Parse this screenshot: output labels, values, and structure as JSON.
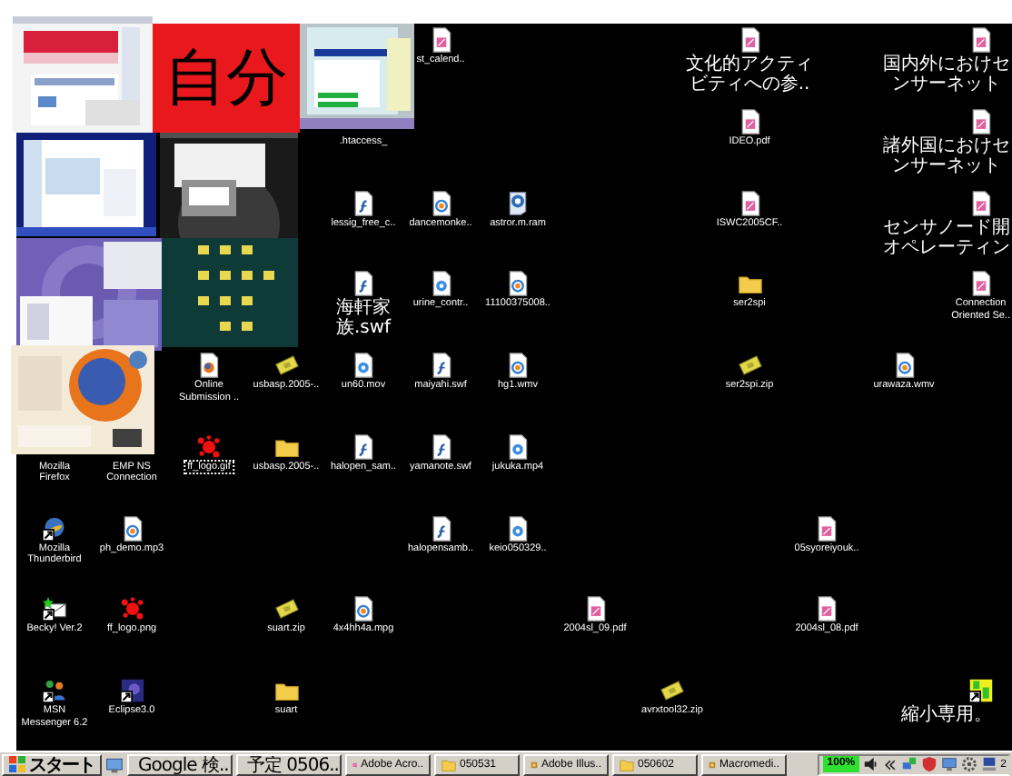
{
  "collage": {
    "badge": "自分"
  },
  "desktop": {
    "icons": [
      {
        "label": "st_calend..",
        "kind": "pdf",
        "shortcut": false,
        "selected": false
      },
      {
        "label": "文化的アクティビティへの参..",
        "kind": "pdf",
        "shortcut": false,
        "selected": false
      },
      {
        "label": "国内外におけセンサーネット",
        "kind": "pdf",
        "shortcut": false,
        "selected": false
      },
      {
        "label": ".htaccess_",
        "kind": "hidden",
        "selected": false
      },
      {
        "label": "IDEO.pdf",
        "kind": "pdf",
        "shortcut": false,
        "selected": false
      },
      {
        "label": "諸外国におけセンサーネット",
        "kind": "pdf",
        "shortcut": false,
        "selected": false
      },
      {
        "label": "lessig_free_c..",
        "kind": "swf",
        "shortcut": false,
        "selected": false
      },
      {
        "label": "dancemonke..",
        "kind": "wmv",
        "shortcut": false,
        "selected": false
      },
      {
        "label": "astror.m.ram",
        "kind": "ram",
        "shortcut": false,
        "selected": false
      },
      {
        "label": "ISWC2005CF..",
        "kind": "pdf",
        "shortcut": false,
        "selected": false
      },
      {
        "label": "センサノード開オペレーティン",
        "kind": "pdf",
        "shortcut": false,
        "selected": false
      },
      {
        "label": "海軒家族.swf",
        "kind": "swf",
        "shortcut": false,
        "selected": false
      },
      {
        "label": "urine_contr..",
        "kind": "qt",
        "shortcut": false,
        "selected": false
      },
      {
        "label": "11100375008..",
        "kind": "wmv",
        "shortcut": false,
        "selected": false
      },
      {
        "label": "ser2spi",
        "kind": "folder",
        "shortcut": false,
        "selected": false
      },
      {
        "label": "Connection\nOriented Se..",
        "kind": "pdf",
        "shortcut": false,
        "selected": false
      },
      {
        "label": "Online\nSubmission ..",
        "kind": "webdoc",
        "shortcut": false,
        "selected": false
      },
      {
        "label": "usbasp.2005-..",
        "kind": "zip",
        "shortcut": false,
        "selected": false
      },
      {
        "label": "un60.mov",
        "kind": "qt",
        "shortcut": false,
        "selected": false
      },
      {
        "label": "maiyahi.swf",
        "kind": "swf",
        "shortcut": false,
        "selected": false
      },
      {
        "label": "hg1.wmv",
        "kind": "wmv",
        "shortcut": false,
        "selected": false
      },
      {
        "label": "ser2spi.zip",
        "kind": "zip",
        "shortcut": false,
        "selected": false
      },
      {
        "label": "urawaza.wmv",
        "kind": "wmv",
        "shortcut": false,
        "selected": false
      },
      {
        "label": "Mozilla\nFirefox",
        "kind": "hidden",
        "selected": false
      },
      {
        "label": "EMP NS\nConnection",
        "kind": "hidden",
        "selected": false
      },
      {
        "label": "ff_logo.gif",
        "kind": "splat",
        "shortcut": false,
        "selected": true
      },
      {
        "label": "usbasp.2005-..",
        "kind": "folder",
        "shortcut": false,
        "selected": false
      },
      {
        "label": "halopen_sam..",
        "kind": "swf",
        "shortcut": false,
        "selected": false
      },
      {
        "label": "yamanote.swf",
        "kind": "swf",
        "shortcut": false,
        "selected": false
      },
      {
        "label": "jukuka.mp4",
        "kind": "qt",
        "shortcut": false,
        "selected": false
      },
      {
        "label": "Mozilla\nThunderbird",
        "kind": "thunderbird",
        "shortcut": true,
        "selected": false
      },
      {
        "label": "ph_demo.mp3",
        "kind": "wmv",
        "shortcut": false,
        "selected": false
      },
      {
        "label": "halopensamb..",
        "kind": "swf",
        "shortcut": false,
        "selected": false
      },
      {
        "label": "keio050329..",
        "kind": "qt",
        "shortcut": false,
        "selected": false
      },
      {
        "label": "05syoreiyouk..",
        "kind": "pdf",
        "shortcut": false,
        "selected": false
      },
      {
        "label": "Becky! Ver.2",
        "kind": "becky",
        "shortcut": true,
        "selected": false
      },
      {
        "label": "ff_logo.png",
        "kind": "splat",
        "shortcut": false,
        "selected": false
      },
      {
        "label": "suart.zip",
        "kind": "zip",
        "shortcut": false,
        "selected": false
      },
      {
        "label": "4x4hh4a.mpg",
        "kind": "wmv",
        "shortcut": false,
        "selected": false
      },
      {
        "label": "2004sl_09.pdf",
        "kind": "pdf",
        "shortcut": false,
        "selected": false
      },
      {
        "label": "2004sl_08.pdf",
        "kind": "pdf",
        "shortcut": false,
        "selected": false
      },
      {
        "label": "MSN\nMessenger 6.2",
        "kind": "msn",
        "shortcut": true,
        "selected": false
      },
      {
        "label": "Eclipse3.0",
        "kind": "eclipse",
        "shortcut": true,
        "selected": false
      },
      {
        "label": "suart",
        "kind": "folder",
        "shortcut": false,
        "selected": false
      },
      {
        "label": "avrxtool32.zip",
        "kind": "zip",
        "shortcut": false,
        "selected": false
      },
      {
        "label": "縮小専用。",
        "kind": "app",
        "shortcut": true,
        "selected": false
      }
    ]
  },
  "taskbar": {
    "start": "スタート",
    "buttons": [
      {
        "label": "Google 検..",
        "kind": "browser"
      },
      {
        "label": "予定 0506..",
        "kind": "calendar"
      },
      {
        "label": "Adobe Acro..",
        "kind": "pdf"
      },
      {
        "label": "050531",
        "kind": "folder"
      },
      {
        "label": "Adobe Illus..",
        "kind": "app"
      },
      {
        "label": "050602",
        "kind": "folder"
      },
      {
        "label": "Macromedi..",
        "kind": "app"
      }
    ],
    "zoom": "100%",
    "clock": "2"
  }
}
